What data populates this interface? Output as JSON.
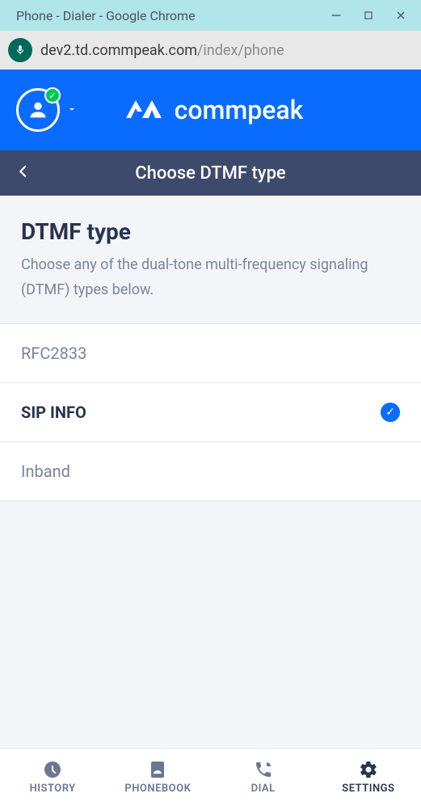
{
  "window": {
    "title": "Phone - Dialer - Google Chrome"
  },
  "url": {
    "host": "dev2.td.commpeak.com",
    "path": "/index/phone"
  },
  "brand": "commpeak",
  "subheader": {
    "title": "Choose DTMF type"
  },
  "section": {
    "title": "DTMF type",
    "desc": "Choose any of the dual-tone multi-frequency signaling (DTMF) types below."
  },
  "options": [
    {
      "label": "RFC2833",
      "selected": false
    },
    {
      "label": "SIP INFO",
      "selected": true
    },
    {
      "label": "Inband",
      "selected": false
    }
  ],
  "nav": {
    "history": "HISTORY",
    "phonebook": "PHONEBOOK",
    "dial": "DIAL",
    "settings": "SETTINGS",
    "active": "settings"
  }
}
